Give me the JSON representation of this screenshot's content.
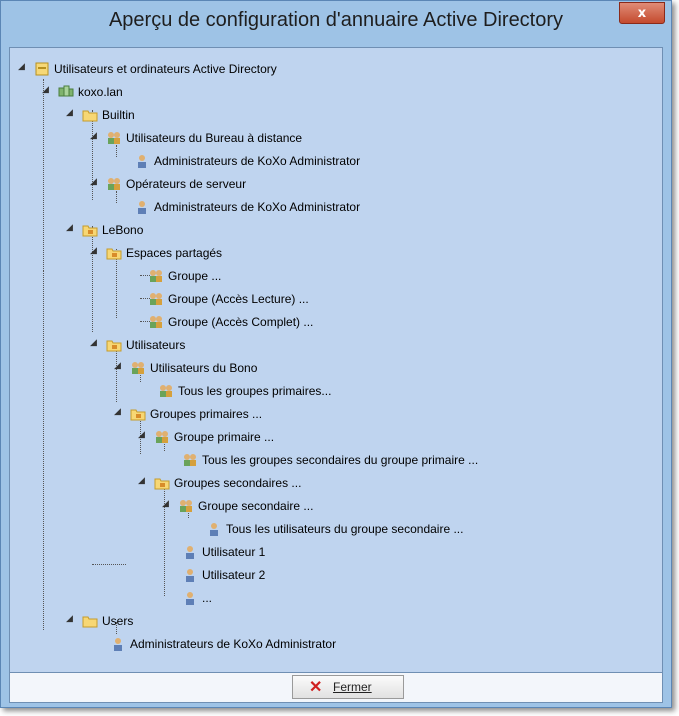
{
  "window": {
    "title": "Aperçu de configuration d'annuaire Active Directory",
    "close_glyph": "x",
    "title_bg": "#9ec3e6"
  },
  "tree": {
    "nodes": [
      {
        "label": "Utilisateurs et ordinateurs Active Directory",
        "icon": "ad-root-icon",
        "expanded": true
      },
      {
        "label": "koxo.lan",
        "icon": "domain-icon",
        "expanded": true
      },
      {
        "label": "Builtin",
        "icon": "folder-icon",
        "expanded": true
      },
      {
        "label": "Utilisateurs du Bureau à distance",
        "icon": "group-icon",
        "expanded": true
      },
      {
        "label": "Administrateurs de KoXo Administrator",
        "icon": "user-icon"
      },
      {
        "label": "Opérateurs de serveur",
        "icon": "group-icon",
        "expanded": true
      },
      {
        "label": "Administrateurs de KoXo Administrator",
        "icon": "user-icon"
      },
      {
        "label": "LeBono",
        "icon": "ou-icon",
        "expanded": true
      },
      {
        "label": "Espaces partagés",
        "icon": "ou-icon",
        "expanded": true
      },
      {
        "label": "Groupe ...",
        "icon": "group-icon"
      },
      {
        "label": "Groupe (Accès Lecture) ...",
        "icon": "group-icon"
      },
      {
        "label": "Groupe (Accès Complet) ...",
        "icon": "group-icon"
      },
      {
        "label": "Utilisateurs",
        "icon": "ou-icon",
        "expanded": true
      },
      {
        "label": "Utilisateurs du Bono",
        "icon": "group-icon",
        "expanded": true
      },
      {
        "label": "Tous les groupes primaires...",
        "icon": "group-icon"
      },
      {
        "label": "Groupes primaires ...",
        "icon": "ou-icon",
        "expanded": true
      },
      {
        "label": "Groupe primaire ...",
        "icon": "group-icon",
        "expanded": true
      },
      {
        "label": "Tous les groupes secondaires du groupe primaire ...",
        "icon": "group-icon"
      },
      {
        "label": "Groupes secondaires ...",
        "icon": "ou-icon",
        "expanded": true
      },
      {
        "label": "Groupe secondaire ...",
        "icon": "group-icon",
        "expanded": true
      },
      {
        "label": "Tous les utilisateurs du groupe secondaire ...",
        "icon": "user-icon"
      },
      {
        "label": "Utilisateur 1",
        "icon": "user-icon"
      },
      {
        "label": "Utilisateur 2",
        "icon": "user-icon"
      },
      {
        "label": "...",
        "icon": "user-icon"
      },
      {
        "label": "Users",
        "icon": "folder-icon",
        "expanded": true
      },
      {
        "label": "Administrateurs de KoXo Administrator",
        "icon": "user-icon"
      }
    ]
  },
  "footer": {
    "close_button_label": "Fermer",
    "close_button_icon": "red-x-icon"
  }
}
